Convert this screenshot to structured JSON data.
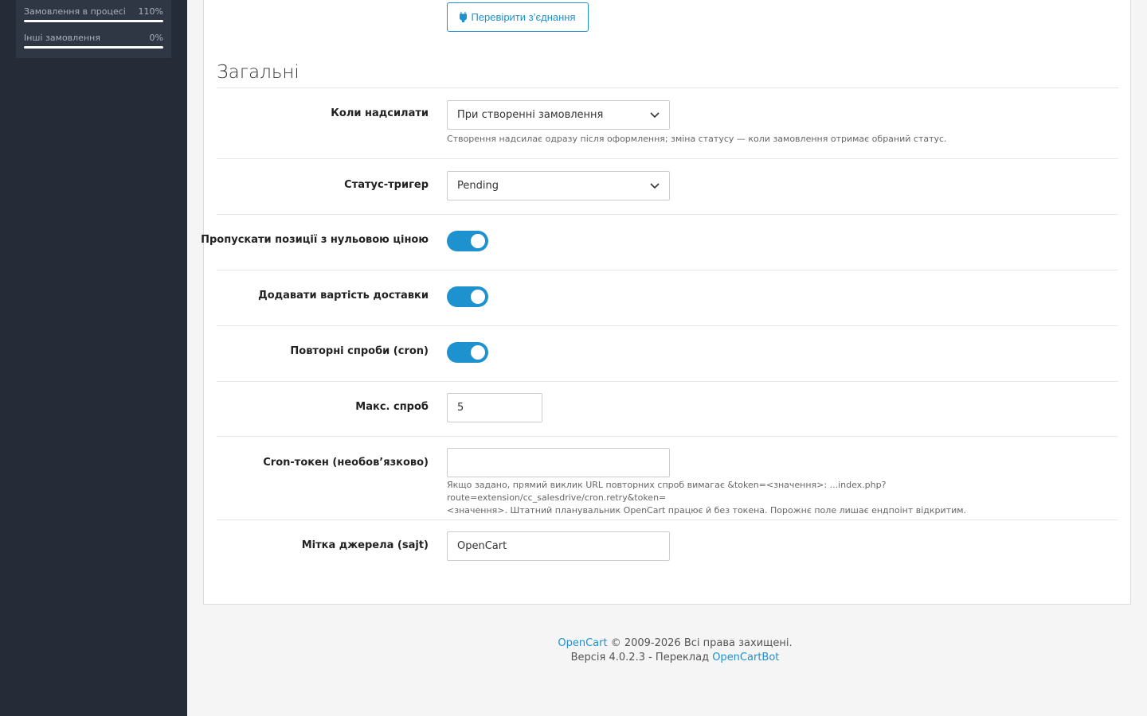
{
  "sidebar": {
    "stats": [
      {
        "label": "Замовлення в процесі",
        "percent": "110%"
      },
      {
        "label": "Інші замовлення",
        "percent": "0%"
      }
    ]
  },
  "toolbar": {
    "test_connection_label": "Перевірити з’єднання"
  },
  "section": {
    "title": "Загальні"
  },
  "fields": {
    "send_when": {
      "label": "Коли надсилати",
      "value": "При створенні замовлення",
      "help": "Створення надсилає одразу після оформлення; зміна статусу — коли замовлення отримає обраний статус."
    },
    "trigger_status": {
      "label": "Статус-тригер",
      "value": "Pending"
    },
    "skip_zero_price": {
      "label": "Пропускати позиції з нульовою ціною",
      "enabled": true
    },
    "add_shipping": {
      "label": "Додавати вартість доставки",
      "enabled": true
    },
    "retries_cron": {
      "label": "Повторні спроби (cron)",
      "enabled": true
    },
    "max_attempts": {
      "label": "Макс. спроб",
      "value": "5"
    },
    "cron_token": {
      "label": "Cron-токен (необов’язково)",
      "value": "",
      "help_line1": "Якщо задано, прямий виклик URL повторних спроб вимагає &token=<значення>: ...index.php?route=extension/cc_salesdrive/cron.retry&token=",
      "help_line2": "<значення>. Штатний планувальник OpenCart працює й без токена. Порожнє поле лишає ендпоінт відкритим."
    },
    "source_label": {
      "label": "Мітка джерела (sajt)",
      "value": "OpenCart"
    }
  },
  "footer": {
    "brand_link": "OpenCart",
    "copyright": " © 2009-2026 Всі права захищені.",
    "version_text": "Версія 4.0.2.3 - Переклад ",
    "translator_link": "OpenCartBot"
  },
  "colors": {
    "accent": "#1e91cf",
    "sidebar": "#252c38"
  }
}
